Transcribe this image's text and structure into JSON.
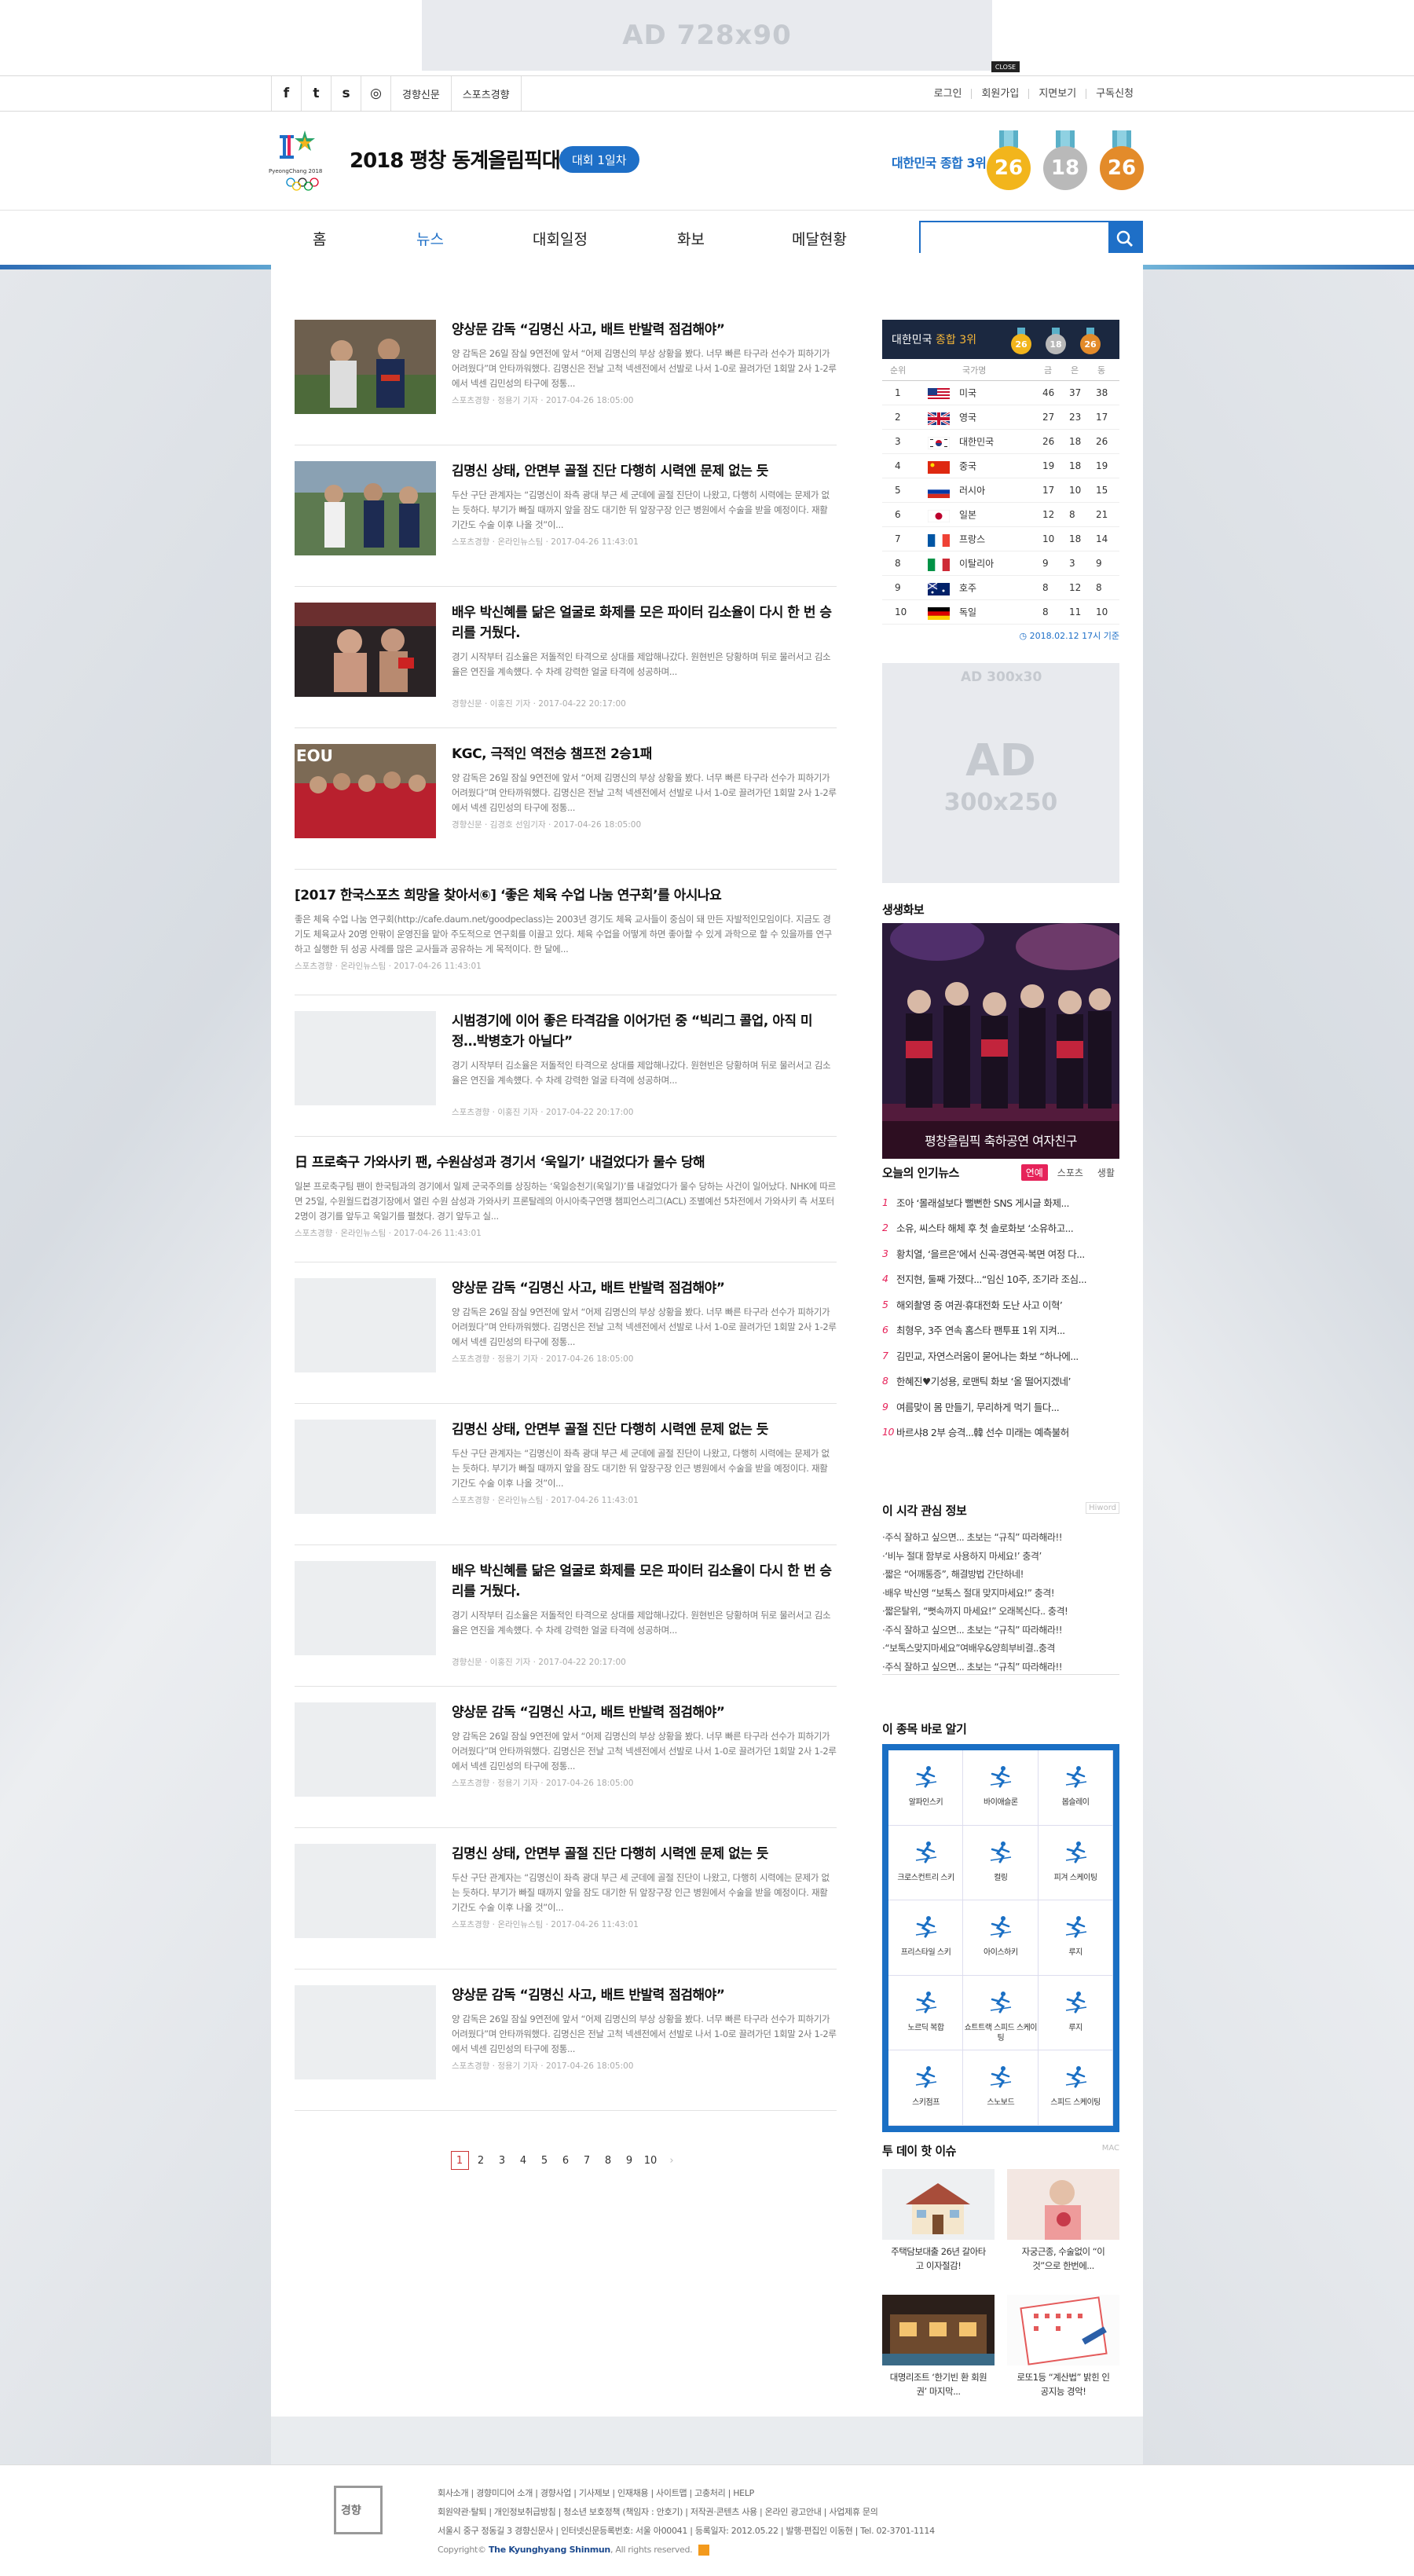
{
  "ad_top": {
    "label": "AD 728x90",
    "close": "CLOSE"
  },
  "util": {
    "social_icons": [
      "facebook-icon",
      "twitter-icon",
      "story-icon",
      "instagram-icon"
    ],
    "social_glyphs": [
      "f",
      "t",
      "s",
      "◎"
    ],
    "sites": [
      "경향신문",
      "스포츠경향"
    ],
    "links": [
      "로그인",
      "회원가입",
      "지면보기",
      "구독신청"
    ]
  },
  "header": {
    "logo_caption": "PyeongChang 2018",
    "title": "2018 평창 동계올림픽대회",
    "day_badge": "대회 1일차",
    "korea_rank": "대한민국 종합 3위",
    "medals": [
      {
        "type": "gold",
        "count": "26",
        "color": "#f2b51c"
      },
      {
        "type": "silver",
        "count": "18",
        "color": "#b9b9b9"
      },
      {
        "type": "bronze",
        "count": "26",
        "color": "#e38b2a"
      }
    ]
  },
  "nav": {
    "items": [
      "홈",
      "뉴스",
      "대회일정",
      "화보",
      "메달현황"
    ],
    "active": "뉴스",
    "search_placeholder": ""
  },
  "articles": [
    {
      "title": "양상문 감독 “김명신 사고, 배트 반발력 점검해야”",
      "summary": "양 감독은 26일 잠실 9연전에 앞서 “어제 김명신의 부상 상황을 봤다. 너무 빠른 타구라 선수가 피하기가 어려웠다”며 안타까워했다. 김명신은 전날 고척 넥센전에서 선발로 나서 1-0로 끌려가던 1회말 2사 1-2루에서 넥센 김민성의 타구에 정통...",
      "meta": "스포츠경향 · 정용기 기자 · 2017-04-26 18:05:00",
      "thumb": "baseball"
    },
    {
      "title": "김명신 상태, 안면부 골절 진단 다행히 시력엔 문제 없는 듯",
      "summary": "두산 구단 관계자는 “김명신이 좌측 광대 부근 세 군데에 골절 진단이 나왔고, 다행히 시력에는 문제가 없는 듯하다. 부기가 빠질 때까지 앞을 잠도 대기한 뒤 앞장구장 인근 병원에서 수술을 받을 예정이다. 재활 기간도 수술 이후 나올 것”이...",
      "meta": "스포츠경향 · 온라인뉴스팀 · 2017-04-26 11:43:01",
      "thumb": "baseball2"
    },
    {
      "title": "배우 박신혜를 닮은 얼굴로 화제를 모은 파이터 김소율이 다시 한 번 승리를 거뒀다.",
      "summary": "경기 시작부터 김소율은 저돌적인 타격으로 상대를 제압해나갔다. 원현빈은 당황하며 뒤로 물러서고 김소율은 연진을 계속헀다. 수 차례 강력한 얼굴 타격에 성공하며...",
      "meta": "경향신문 · 이홍진 기자 · 2017-04-22 20:17:00",
      "thumb": "fight"
    },
    {
      "title": "KGC, 극적인 역전승 챔프전 2승1패",
      "summary": "양 감독은 26일 잠실 9연전에 앞서 “어제 김명신의 부상 상황을 봤다. 너무 빠른 타구라 선수가 피하기가 어려웠다”며 안타까워했다. 김명신은 전날 고척 넥센전에서 선발로 나서 1-0로 끌려가던 1회말 2사 1-2루에서 넥센 김민성의 타구에 정통...",
      "meta": "경향신문 · 김경호 선임기자 · 2017-04-26 18:05:00",
      "thumb": "basket"
    },
    {
      "title": "[2017 한국스포츠 희망을 찾아서⑥] ‘좋은 체육 수업 나눔 연구회’를 아시나요",
      "summary": "좋은 체육 수업 나눔 연구회(http://cafe.daum.net/goodpeclass)는 2003년 경기도 체육 교사들이 중심이 돼 만든 자발적인모임이다. 지금도 경기도 체육교사 20명 안팎이 운영진을 맡아 주도적으로 연구회를 이끌고 있다. 체육 수업을 어떻게 하면 좋아할 수 있게 과학으로 할 수 있을까를 연구하고 실행한 뒤 성공 사례를 많은 교사들과 공유하는 게 목적이다. 한 달에...",
      "meta": "스포츠경향 · 온라인뉴스팀 · 2017-04-26 11:43:01",
      "thumb": "none"
    },
    {
      "title": "시범경기에 이어 좋은 타격감을 이어가던 중 “빅리그 콜업, 아직 미정…박병호가 아닐다”",
      "summary": "경기 시작부터 김소율은 저돌적인 타격으로 상대를 제압해나갔다. 원현빈은 당황하며 뒤로 물러서고 김소율은 연진을 계속헀다. 수 차례 강력한 얼굴 타격에 성공하며...",
      "meta": "스포츠경향 · 이홍진 기자 · 2017-04-22 20:17:00",
      "thumb": "blank"
    },
    {
      "title": "日 프로축구 가와사키 팬, 수원삼성과 경기서 ‘욱일기’ 내걸었다가 물수 당해",
      "summary": "일본 프로축구팀 팬이 한국팀과의 경기에서 일제 군국주의를 상징하는 ‘욱일승천기(욱일기)’를 내걸었다가 물수 당하는 사건이 일어났다. NHK에 따르면 25일, 수원월드컵경기장에서 열린 수원 삼성과 가와사키 프론탈레의 아시아축구연맹 챔피언스리그(ACL) 조별예선 5차전에서 가와사키 측 서포터 2명이 경기를 앞두고 욱일기를 펼쳤다. 경기 앞두고 실...",
      "meta": "스포츠경향 · 온라인뉴스팀 · 2017-04-26 11:43:01",
      "thumb": "none"
    },
    {
      "title": "양상문 감독 “김명신 사고, 배트 반발력 점검해야”",
      "summary": "양 감독은 26일 잠실 9연전에 앞서 “어제 김명신의 부상 상황을 봤다. 너무 빠른 타구라 선수가 피하기가 어려웠다”며 안타까워했다. 김명신은 전날 고척 넥센전에서 선발로 나서 1-0로 끌려가던 1회말 2사 1-2루에서 넥센 김민성의 타구에 정통...",
      "meta": "스포츠경향 · 정용기 기자 · 2017-04-26 18:05:00",
      "thumb": "blank"
    },
    {
      "title": "김명신 상태, 안면부 골절 진단 다행히 시력엔 문제 없는 듯",
      "summary": "두산 구단 관계자는 “김명신이 좌측 광대 부근 세 군데에 골절 진단이 나왔고, 다행히 시력에는 문제가 없는 듯하다. 부기가 빠질 때까지 앞을 잠도 대기한 뒤 앞장구장 인근 병원에서 수술을 받을 예정이다. 재활 기간도 수술 이후 나올 것”이...",
      "meta": "스포츠경향 · 온라인뉴스팀 · 2017-04-26 11:43:01",
      "thumb": "blank"
    },
    {
      "title": "배우 박신혜를 닮은 얼굴로 화제를 모은 파이터 김소율이 다시 한 번 승리를 거뒀다.",
      "summary": "경기 시작부터 김소율은 저돌적인 타격으로 상대를 제압해나갔다. 원현빈은 당황하며 뒤로 물러서고 김소율은 연진을 계속헀다. 수 차례 강력한 얼굴 타격에 성공하며...",
      "meta": "경향신문 · 이홍진 기자 · 2017-04-22 20:17:00",
      "thumb": "blank"
    },
    {
      "title": "양상문 감독 “김명신 사고, 배트 반발력 점검해야”",
      "summary": "양 감독은 26일 잠실 9연전에 앞서 “어제 김명신의 부상 상황을 봤다. 너무 빠른 타구라 선수가 피하기가 어려웠다”며 안타까워했다. 김명신은 전날 고척 넥센전에서 선발로 나서 1-0로 끌려가던 1회말 2사 1-2루에서 넥센 김민성의 타구에 정통...",
      "meta": "스포츠경향 · 정용기 기자 · 2017-04-26 18:05:00",
      "thumb": "blank"
    },
    {
      "title": "김명신 상태, 안면부 골절 진단 다행히 시력엔 문제 없는 듯",
      "summary": "두산 구단 관계자는 “김명신이 좌측 광대 부근 세 군데에 골절 진단이 나왔고, 다행히 시력에는 문제가 없는 듯하다. 부기가 빠질 때까지 앞을 잠도 대기한 뒤 앞장구장 인근 병원에서 수술을 받을 예정이다. 재활 기간도 수술 이후 나올 것”이...",
      "meta": "스포츠경향 · 온라인뉴스팀 · 2017-04-26 11:43:01",
      "thumb": "blank"
    },
    {
      "title": "양상문 감독 “김명신 사고, 배트 반발력 점검해야”",
      "summary": "양 감독은 26일 잠실 9연전에 앞서 “어제 김명신의 부상 상황을 봤다. 너무 빠른 타구라 선수가 피하기가 어려웠다”며 안타까워했다. 김명신은 전날 고척 넥센전에서 선발로 나서 1-0로 끌려가던 1회말 2사 1-2루에서 넥센 김민성의 타구에 정통...",
      "meta": "스포츠경향 · 정용기 기자 · 2017-04-26 18:05:00",
      "thumb": "blank"
    }
  ],
  "pagination": {
    "pages": [
      "1",
      "2",
      "3",
      "4",
      "5",
      "6",
      "7",
      "8",
      "9",
      "10"
    ],
    "current": "1",
    "next": "›"
  },
  "medal_table": {
    "title_prefix": "대한민국",
    "title_rank": "종합 3위",
    "totals": [
      "26",
      "18",
      "26"
    ],
    "headers": [
      "순위",
      "국가명",
      "금",
      "은",
      "동"
    ],
    "rows": [
      {
        "rank": "1",
        "country": "미국",
        "g": "46",
        "s": "37",
        "b": "38",
        "flag": "us"
      },
      {
        "rank": "2",
        "country": "영국",
        "g": "27",
        "s": "23",
        "b": "17",
        "flag": "uk"
      },
      {
        "rank": "3",
        "country": "대한민국",
        "g": "26",
        "s": "18",
        "b": "26",
        "flag": "kr"
      },
      {
        "rank": "4",
        "country": "중국",
        "g": "19",
        "s": "18",
        "b": "19",
        "flag": "cn"
      },
      {
        "rank": "5",
        "country": "러시아",
        "g": "17",
        "s": "10",
        "b": "15",
        "flag": "ru"
      },
      {
        "rank": "6",
        "country": "일본",
        "g": "12",
        "s": "8",
        "b": "21",
        "flag": "jp"
      },
      {
        "rank": "7",
        "country": "프랑스",
        "g": "10",
        "s": "18",
        "b": "14",
        "flag": "fr"
      },
      {
        "rank": "8",
        "country": "이탈리아",
        "g": "9",
        "s": "3",
        "b": "9",
        "flag": "it"
      },
      {
        "rank": "9",
        "country": "호주",
        "g": "8",
        "s": "12",
        "b": "8",
        "flag": "au"
      },
      {
        "rank": "10",
        "country": "독일",
        "g": "8",
        "s": "11",
        "b": "10",
        "flag": "de"
      }
    ],
    "updated": "2018.02.12 17시 기준"
  },
  "side_ad": {
    "small": "AD 300x30",
    "big": "AD",
    "size": "300x250"
  },
  "photo": {
    "title": "생생화보",
    "caption": "평창올림픽 축하공연 여자친구"
  },
  "popular": {
    "title": "오늘의 인기뉴스",
    "tabs": [
      "연예",
      "스포츠",
      "생활"
    ],
    "active": "연예",
    "items": [
      "조아 ‘몰래설보다 뻘뻔한 SNS 게시글 화제...",
      "소유, 씨스타 해체 후 첫 솔로화보 ‘소유하고...",
      "황치열, ‘을르은’에서 신곡·경연곡·복면 여정 다...",
      "전지현, 둘째 가졌다...“임신 10주, 조기라 조심...",
      "해외촬영 중 여권·휴대전화 도난 사고 이혁’",
      "최형우, 3주 연속 홈스타 팬투표 1위 지켜...",
      "김민교, 자연스러움이 묻어나는 화보 “하나에...",
      "한혜진♥기성용, 로맨틱 화보 ‘올 떨어지겠네’",
      "여름맞이 몸 만들기, 무리하게 먹기 들다...",
      "바르샤8 2부 승격...韓 선수 미래는 예측불허"
    ]
  },
  "interest": {
    "title": "이 시각 관심 정보",
    "tag": "Hiword",
    "items": [
      "·주식 잘하고 싶으면... 초보는 “규칙” 따라해라!!",
      "·‘비누 절대 함부로 사용하지 마세요!’ 충격’",
      "·짧은 “어깨통증”, 해결방법 간단하네!",
      "·배우 박신영 “보톡스 절대 맞지마세요!” 충격!",
      "·짧은탈위, “뻣속까지 마세요!” 오래복신다.. 충격!",
      "·주식 잘하고 싶으면... 초보는 “규칙” 따라해라!!",
      "·“보톡스맞지마세요”여배우&양희부비결..충격",
      "·주식 잘하고 싶으면... 초보는 “규칙” 따라해라!!"
    ]
  },
  "sports": {
    "title": "이 종목 바로 알기",
    "items": [
      {
        "name": "알파인스키",
        "icon": "alpine-ski-icon"
      },
      {
        "name": "바이애슬론",
        "icon": "biathlon-icon"
      },
      {
        "name": "봅슬레이",
        "icon": "bobsleigh-icon"
      },
      {
        "name": "크로스컨트리 스키",
        "icon": "cross-country-icon"
      },
      {
        "name": "컬링",
        "icon": "curling-icon"
      },
      {
        "name": "피겨 스케이팅",
        "icon": "figure-skating-icon"
      },
      {
        "name": "프리스타일 스키",
        "icon": "freestyle-ski-icon"
      },
      {
        "name": "아이스하키",
        "icon": "ice-hockey-icon"
      },
      {
        "name": "루지",
        "icon": "luge-icon"
      },
      {
        "name": "노르딕 복합",
        "icon": "nordic-combined-icon"
      },
      {
        "name": "쇼트트랙 스피드 스케이팅",
        "icon": "short-track-icon"
      },
      {
        "name": "루지",
        "icon": "skeleton-icon"
      },
      {
        "name": "스키점프",
        "icon": "ski-jump-icon"
      },
      {
        "name": "스노보드",
        "icon": "snowboard-icon"
      },
      {
        "name": "스피드 스케이팅",
        "icon": "speed-skating-icon"
      }
    ]
  },
  "hot": {
    "title": "투 데이 핫 이슈",
    "tag": "MAC",
    "items": [
      {
        "text": "주택담보대출 26년 갈아타고 이자절감!",
        "img": "house"
      },
      {
        "text": "자궁근종, 수술없이 “이것”으로 한번에...",
        "img": "woman"
      },
      {
        "text": "대명리조트 ‘한기빈 환 회원권’ 마지막...",
        "img": "resort"
      },
      {
        "text": "로또1등 “계산법” 밝힌 인공지능 경악!",
        "img": "lotto"
      }
    ]
  },
  "footer": {
    "logo": "경향",
    "links": "회사소개 | 경향미디어 소개 | 경향사업 | 기사제보 | 인재채용 | 사이트맵 | 고충처리 | HELP",
    "links2": "회원약관·탈퇴 | 개인정보취급방침 | 청소년 보호정책 (책임자 : 안호기) | 저작권·콘텐츠 사용 | 온라인 광고안내 | 사업제휴 문의",
    "address": "서울시 중구 정동길 3 경향신문사 | 인터넷신문등록번호: 서울 아00041 | 등록일자: 2012.05.22 | 발행·편집인 이동현 | Tel. 02-3701-1114",
    "copy_prefix": "Copyright© ",
    "copy_name": "The Kyunghyang Shinmun",
    "copy_suffix": ", All rights reserved."
  }
}
